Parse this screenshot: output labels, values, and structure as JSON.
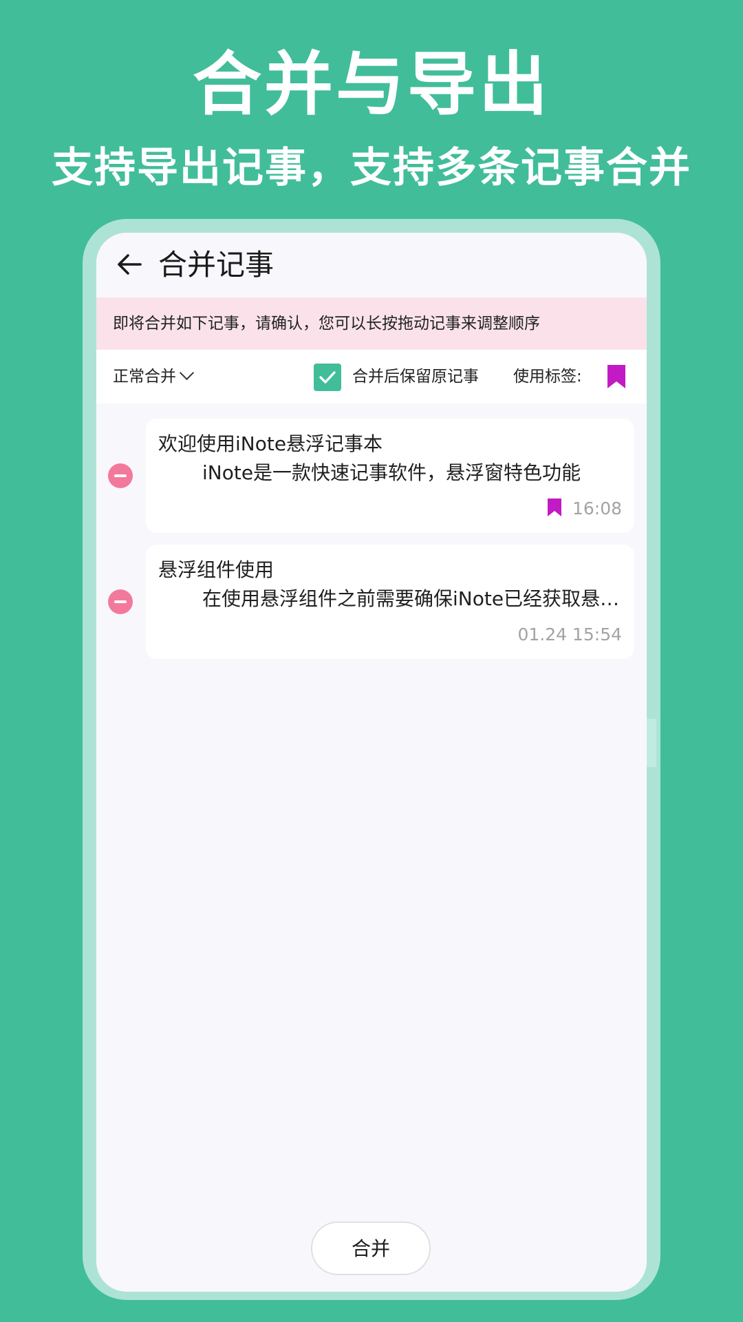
{
  "promo": {
    "title": "合并与导出",
    "subtitle": "支持导出记事，支持多条记事合并"
  },
  "appbar": {
    "back_icon": "arrow-left-icon",
    "title": "合并记事"
  },
  "notice": "即将合并如下记事，请确认，您可以长按拖动记事来调整顺序",
  "options": {
    "mode": "正常合并",
    "keep_original_checked": true,
    "keep_original_label": "合并后保留原记事",
    "tag_label": "使用标签:",
    "tag_color": "#c21ac4"
  },
  "notes": [
    {
      "title": "欢迎使用iNote悬浮记事本",
      "preview": "iNote是一款快速记事软件，悬浮窗特色功能",
      "time": "16:08",
      "has_tag": true
    },
    {
      "title": "悬浮组件使用",
      "preview": "在使用悬浮组件之前需要确保iNote已经获取悬浮窗权限",
      "time": "01.24 15:54",
      "has_tag": false
    }
  ],
  "merge_button": "合并",
  "colors": {
    "accent": "#41bd9a",
    "notice_bg": "#fbe2ea",
    "remove": "#f3799c"
  }
}
